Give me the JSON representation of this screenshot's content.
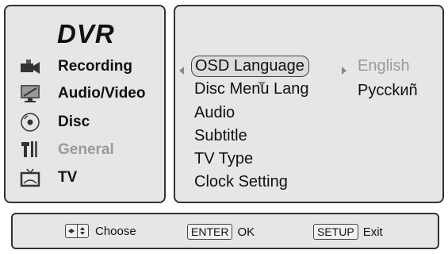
{
  "left_panel": {
    "title": "DVR",
    "items": [
      {
        "label": "Recording"
      },
      {
        "label": "Audio/Video"
      },
      {
        "label": "Disc"
      },
      {
        "label": "General"
      },
      {
        "label": "TV"
      }
    ]
  },
  "menu": {
    "items": [
      {
        "label": "OSD Language"
      },
      {
        "label": "Disc Menu Lang"
      },
      {
        "label": "Audio"
      },
      {
        "label": "Subtitle"
      },
      {
        "label": "TV Type"
      },
      {
        "label": "Clock Setting"
      }
    ],
    "options": [
      {
        "label": "English"
      },
      {
        "label": "Pycckиñ"
      }
    ]
  },
  "bottom_bar": {
    "choose_label": "Choose",
    "enter_key": "ENTER",
    "ok_label": "OK",
    "setup_key": "SETUP",
    "exit_label": "Exit"
  },
  "colors": {
    "panel_bg": "#e6e6e6",
    "dim_text": "#9a9a9a"
  }
}
